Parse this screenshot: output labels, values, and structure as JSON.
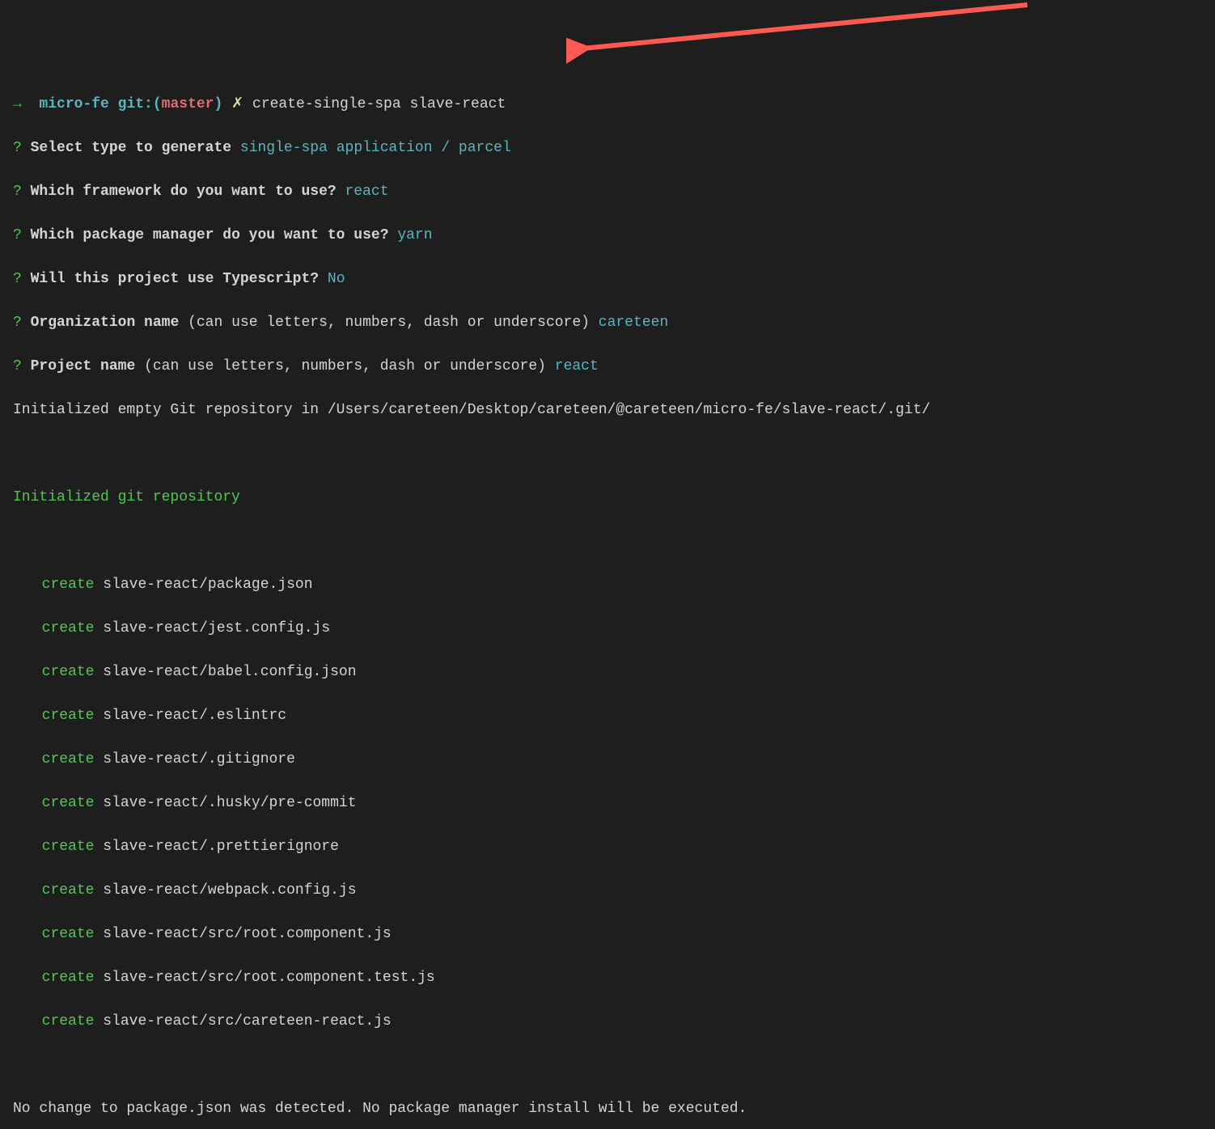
{
  "prompt": {
    "arrow": "→",
    "dir": "micro-fe",
    "git_label": "git:(",
    "branch": "master",
    "git_close": ")",
    "dirty": "✗",
    "command": "create-single-spa slave-react"
  },
  "questions": [
    {
      "mark": "?",
      "q": "Select type to generate",
      "a": "single-spa application / parcel"
    },
    {
      "mark": "?",
      "q": "Which framework do you want to use?",
      "a": "react"
    },
    {
      "mark": "?",
      "q": "Which package manager do you want to use?",
      "a": "yarn"
    },
    {
      "mark": "?",
      "q": "Will this project use Typescript?",
      "a": "No"
    },
    {
      "mark": "?",
      "q": "Organization name",
      "hint": "(can use letters, numbers, dash or underscore)",
      "a": "careteen"
    },
    {
      "mark": "?",
      "q": "Project name",
      "hint": "(can use letters, numbers, dash or underscore)",
      "a": "react"
    }
  ],
  "git_init_msg": "Initialized empty Git repository in /Users/careteen/Desktop/careteen/@careteen/micro-fe/slave-react/.git/",
  "repo_init_msg": "Initialized git repository",
  "creates": [
    {
      "verb": "create",
      "path": "slave-react/package.json"
    },
    {
      "verb": "create",
      "path": "slave-react/jest.config.js"
    },
    {
      "verb": "create",
      "path": "slave-react/babel.config.json"
    },
    {
      "verb": "create",
      "path": "slave-react/.eslintrc"
    },
    {
      "verb": "create",
      "path": "slave-react/.gitignore"
    },
    {
      "verb": "create",
      "path": "slave-react/.husky/pre-commit"
    },
    {
      "verb": "create",
      "path": "slave-react/.prettierignore"
    },
    {
      "verb": "create",
      "path": "slave-react/webpack.config.js"
    },
    {
      "verb": "create",
      "path": "slave-react/src/root.component.js"
    },
    {
      "verb": "create",
      "path": "slave-react/src/root.component.test.js"
    },
    {
      "verb": "create",
      "path": "slave-react/src/careteen-react.js"
    }
  ],
  "no_change_msg": "No change to package.json was detected. No package manager install will be executed."
}
